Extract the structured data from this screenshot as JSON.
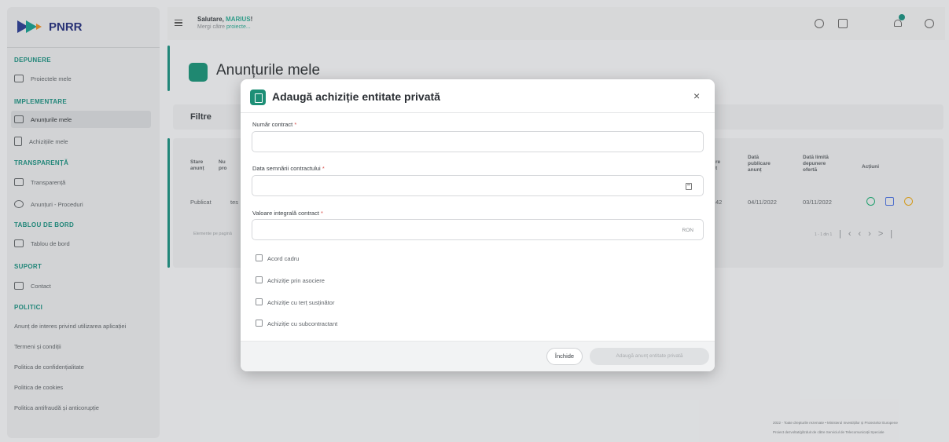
{
  "app": {
    "logo_text": "PNRR",
    "brand_color": "#1f8c7e"
  },
  "sidebar": {
    "sections": [
      {
        "label": "DEPUNERE"
      },
      {
        "label": "IMPLEMENTARE"
      },
      {
        "label": "TRANSPARENȚĂ"
      },
      {
        "label": "TABLOU DE BORD"
      },
      {
        "label": "SUPORT"
      },
      {
        "label": "POLITICI"
      }
    ],
    "items": [
      {
        "label": "Proiectele mele",
        "icon": "folder-plus-icon"
      },
      {
        "label": "Anunțurile mele",
        "icon": "folder-icon"
      },
      {
        "label": "Achizițiile mele",
        "icon": "document-icon"
      },
      {
        "label": "Transparență",
        "icon": "table-icon"
      },
      {
        "label": "Anunțuri - Proceduri",
        "icon": "tag-icon"
      },
      {
        "label": "Tablou de bord",
        "icon": "monitor-icon"
      },
      {
        "label": "Contact",
        "icon": "mail-icon"
      }
    ],
    "policies": [
      "Anunț de interes privind utilizarea aplicației",
      "Termeni și condiții",
      "Politica de confidențialitate",
      "Politica de cookies",
      "Politica antifraudă și anticorupție"
    ]
  },
  "header": {
    "greeting_prefix": "Salutare,",
    "user_name": "MARIUS",
    "greeting_suffix": "!",
    "sub_prefix": "Mergi către",
    "sub_link": "proiecte..."
  },
  "main": {
    "page_title": "Anunțurile mele",
    "filters_label": "Filtre",
    "table": {
      "headers": [
        "Stare anunț",
        "Nu pro",
        "re t",
        "Dată publicare anunț",
        "Dată limită depunere ofertă",
        "Acțiuni"
      ],
      "row": {
        "status": "Publicat",
        "col2": "tes",
        "col3": "42",
        "published": "04/11/2022",
        "deadline": "03/11/2022"
      },
      "per_page_label": "Elemente pe pagină",
      "range_label": "1 - 1 din 1"
    },
    "footer": {
      "line1": "2022 - Toate drepturile rezervate • Ministerul Investițiilor și Proiectelor Europene",
      "line2": "Proiect dezvoltat/găzduit de către Serviciul de Telecomunicații Speciale"
    }
  },
  "modal": {
    "title": "Adaugă achiziție entitate privată",
    "close_symbol": "×",
    "fields": {
      "contract_number": {
        "label": "Număr contract",
        "required": "*",
        "value": ""
      },
      "sign_date": {
        "label": "Data semnării contractului",
        "required": "*",
        "value": ""
      },
      "total_value": {
        "label": "Valoare integrală contract",
        "required": "*",
        "value": "",
        "suffix": "RON"
      }
    },
    "checkboxes": [
      {
        "label": "Acord cadru",
        "checked": false
      },
      {
        "label": "Achiziție prin asociere",
        "checked": false
      },
      {
        "label": "Achiziție cu terț susținător",
        "checked": false
      },
      {
        "label": "Achiziție cu subcontractant",
        "checked": false
      }
    ],
    "buttons": {
      "close": "Închide",
      "submit": "Adaugă anunț entitate privată"
    }
  }
}
